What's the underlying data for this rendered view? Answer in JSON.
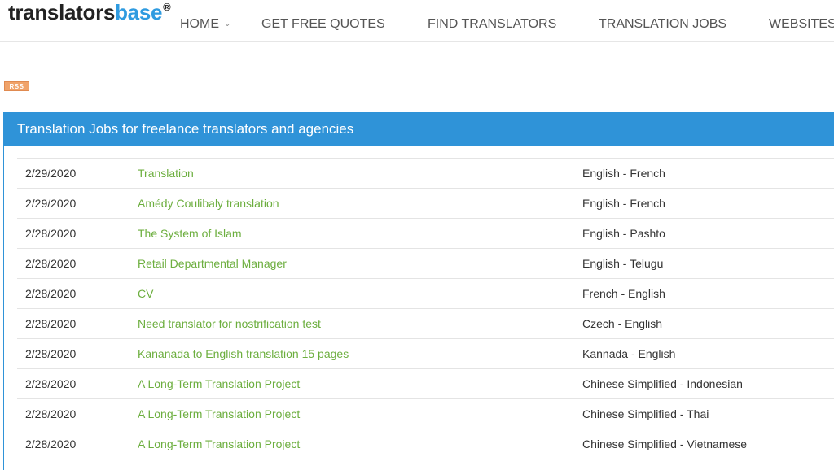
{
  "header": {
    "logo_part1": "translators",
    "logo_part2": "base",
    "logo_mark": "®",
    "nav": [
      {
        "label": "HOME",
        "has_dropdown": true
      },
      {
        "label": "GET FREE QUOTES"
      },
      {
        "label": "FIND TRANSLATORS"
      },
      {
        "label": "TRANSLATION JOBS"
      },
      {
        "label": "WEBSITES"
      }
    ]
  },
  "rss_label": "RSS",
  "panel": {
    "title": "Translation Jobs for freelance translators and agencies"
  },
  "jobs": [
    {
      "date": "2/29/2020",
      "title": "Translation",
      "languages": "English - French"
    },
    {
      "date": "2/29/2020",
      "title": "Amédy Coulibaly translation",
      "languages": "English - French"
    },
    {
      "date": "2/28/2020",
      "title": "The System of Islam",
      "languages": "English - Pashto"
    },
    {
      "date": "2/28/2020",
      "title": "Retail Departmental Manager",
      "languages": "English - Telugu"
    },
    {
      "date": "2/28/2020",
      "title": "CV",
      "languages": "French - English"
    },
    {
      "date": "2/28/2020",
      "title": "Need translator for nostrification test",
      "languages": "Czech - English"
    },
    {
      "date": "2/28/2020",
      "title": "Kananada to English translation 15 pages",
      "languages": "Kannada - English"
    },
    {
      "date": "2/28/2020",
      "title": "A Long-Term Translation Project",
      "languages": "Chinese Simplified - Indonesian"
    },
    {
      "date": "2/28/2020",
      "title": "A Long-Term Translation Project",
      "languages": "Chinese Simplified - Thai"
    },
    {
      "date": "2/28/2020",
      "title": "A Long-Term Translation Project",
      "languages": "Chinese Simplified - Vietnamese"
    }
  ],
  "colors": {
    "brand_blue": "#2f93d8",
    "link_green": "#6cae3e",
    "rss_orange": "#f0a36a"
  }
}
